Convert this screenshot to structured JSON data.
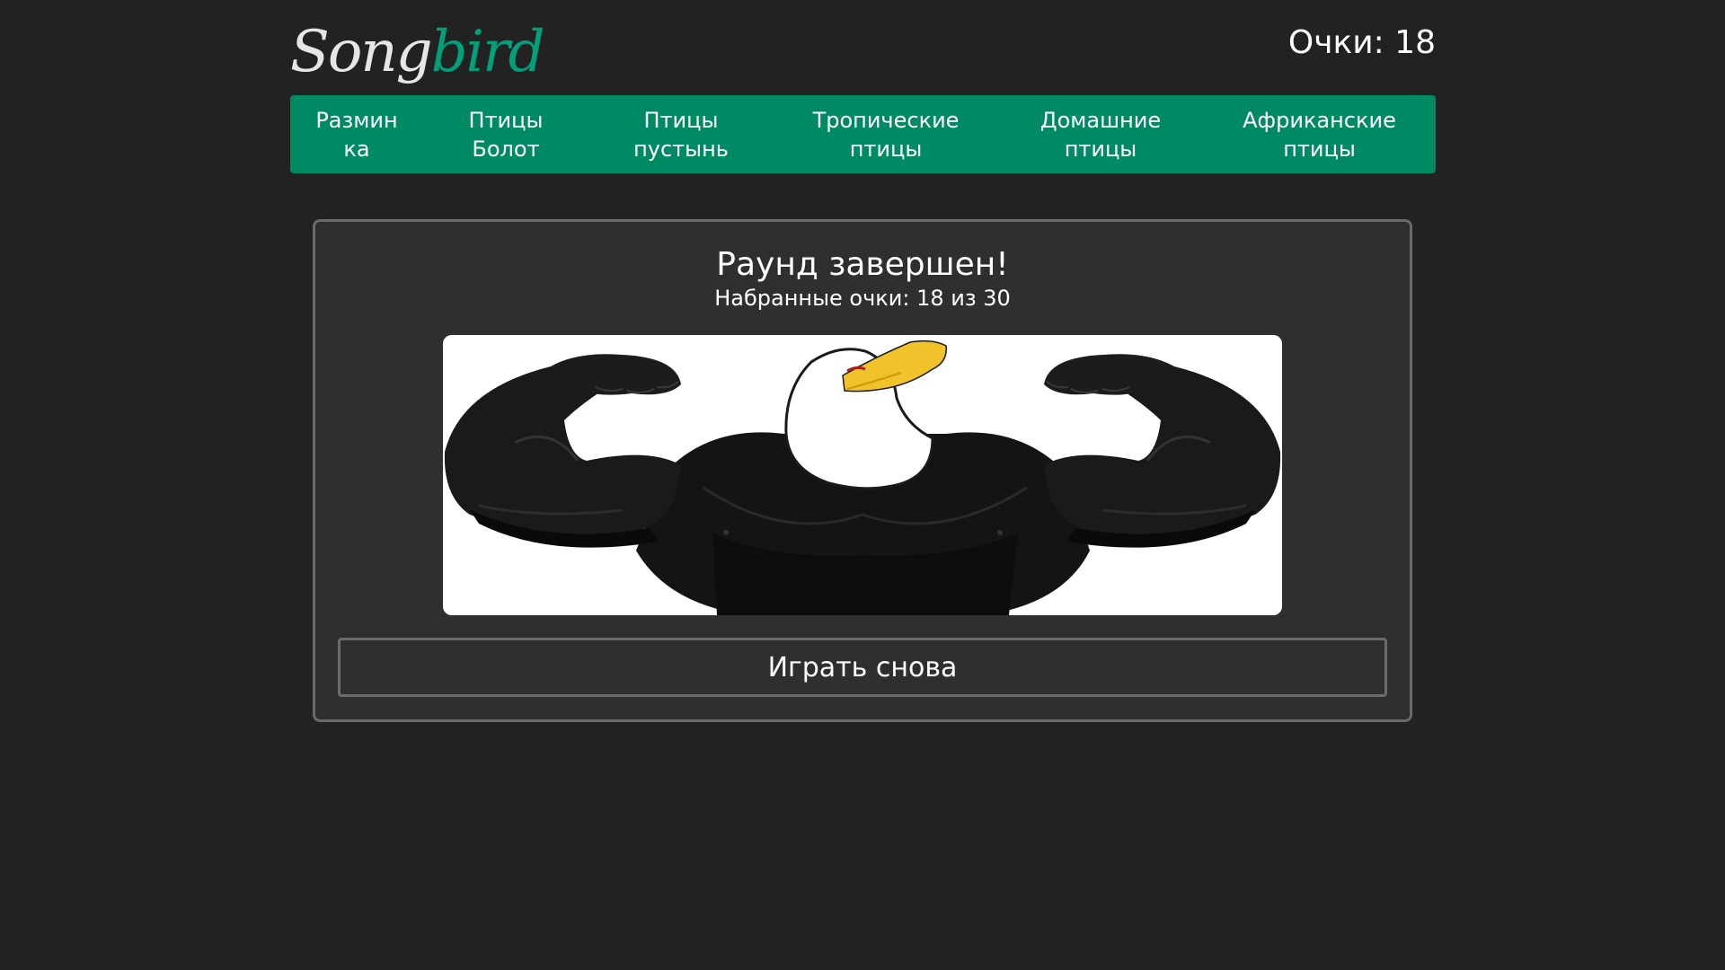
{
  "header": {
    "logo_part1": "Song",
    "logo_part2": "bird",
    "score": "Очки: 18"
  },
  "nav": {
    "items": [
      {
        "line1": "Размин",
        "line2": "ка"
      },
      {
        "line1": "Птицы",
        "line2": "Болот"
      },
      {
        "line1": "Птицы",
        "line2": "пустынь"
      },
      {
        "line1": "Тропические",
        "line2": "птицы"
      },
      {
        "line1": "Домашние",
        "line2": "птицы"
      },
      {
        "line1": "Африканские",
        "line2": "птицы"
      }
    ]
  },
  "result": {
    "title": "Раунд завершен!",
    "subtitle": "Набранные очки: 18 из 30",
    "image": "muscular-eagle-illustration",
    "play_again_label": "Играть снова"
  },
  "colors": {
    "background": "#222222",
    "accent": "#008a64",
    "logo_accent": "#00a07a",
    "card_background": "#2f2f2f",
    "card_border": "#6a6a6a"
  }
}
